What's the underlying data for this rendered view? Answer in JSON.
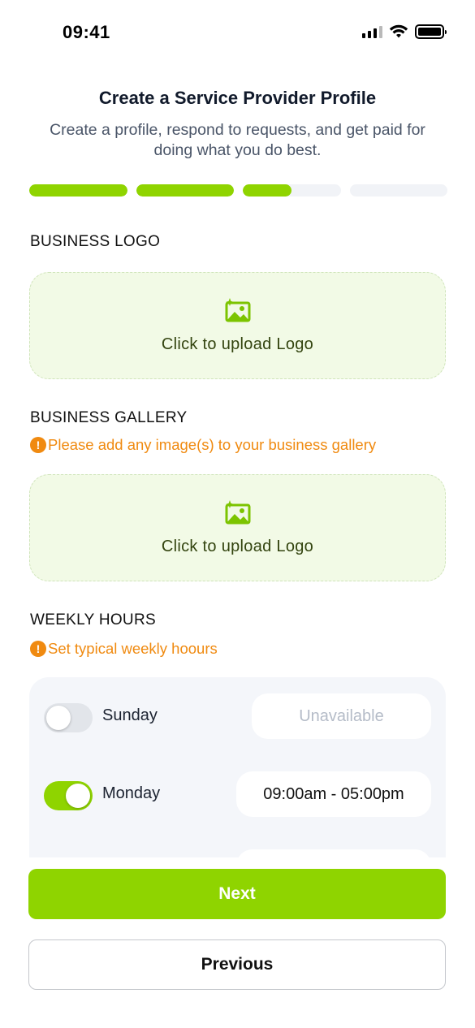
{
  "status_bar": {
    "time": "09:41",
    "icons": [
      "cellular-signal-icon",
      "wifi-icon",
      "battery-icon"
    ]
  },
  "header": {
    "title": "Create a Service Provider Profile",
    "subtitle": "Create a profile, respond to requests, and get paid for doing what you do best."
  },
  "progress": {
    "steps": [
      {
        "fill": 1.0
      },
      {
        "fill": 1.0
      },
      {
        "fill": 0.5
      },
      {
        "fill": 0.0
      }
    ]
  },
  "business_logo": {
    "label": "BUSINESS LOGO",
    "upload_text": "Click to upload Logo",
    "icon": "image-upload-icon"
  },
  "business_gallery": {
    "label": "BUSINESS GALLERY",
    "warning": "Please add any image(s) to your business gallery",
    "upload_text": "Click to upload Logo",
    "icon": "image-upload-icon"
  },
  "weekly_hours": {
    "label": "WEEKLY HOURS",
    "warning": "Set typical weekly hoours",
    "days": [
      {
        "name": "Sunday",
        "enabled": false,
        "hours": "Unavailable"
      },
      {
        "name": "Monday",
        "enabled": true,
        "hours": "09:00am - 05:00pm"
      }
    ]
  },
  "buttons": {
    "next": "Next",
    "previous": "Previous"
  },
  "colors": {
    "accent": "#8fd400",
    "warning": "#f08a10",
    "upload_bg": "#f2fae6",
    "panel_bg": "#f4f6fa"
  }
}
